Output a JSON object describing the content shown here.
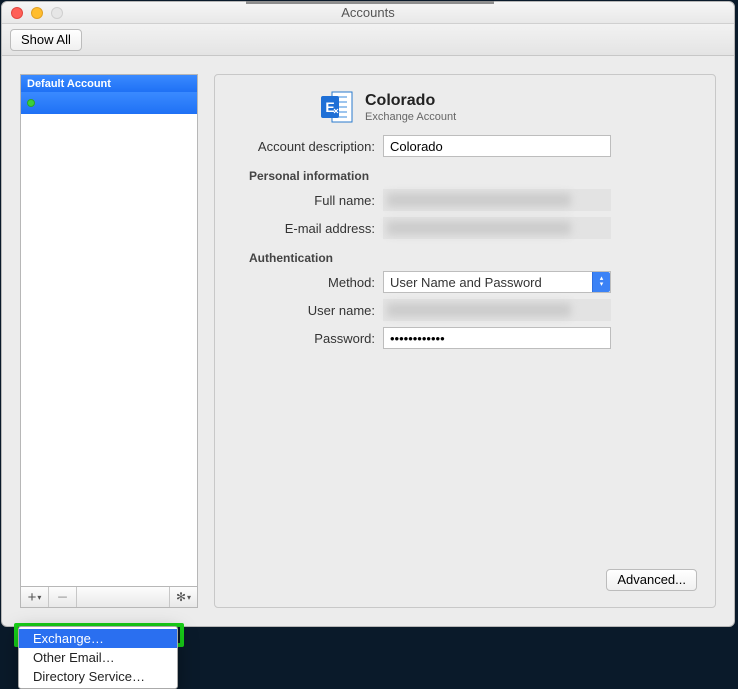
{
  "window": {
    "title": "Accounts",
    "show_all_label": "Show All"
  },
  "sidebar": {
    "header": "Default Account",
    "items": [
      {
        "status": "online",
        "label": ""
      }
    ],
    "footer": {
      "add_glyph": "＋⌄",
      "remove_glyph": "—",
      "gear_glyph": "⚙⌄"
    }
  },
  "popup": {
    "items": [
      {
        "label": "Exchange…",
        "selected": true
      },
      {
        "label": "Other Email…",
        "selected": false
      },
      {
        "label": "Directory Service…",
        "selected": false
      }
    ]
  },
  "detail": {
    "icon": "exchange-icon",
    "account_name": "Colorado",
    "account_type": "Exchange Account",
    "labels": {
      "description": "Account description:",
      "personal_section": "Personal information",
      "full_name": "Full name:",
      "email": "E-mail address:",
      "auth_section": "Authentication",
      "method": "Method:",
      "user": "User name:",
      "password": "Password:",
      "advanced": "Advanced..."
    },
    "values": {
      "description": "Colorado",
      "full_name": "",
      "email": "",
      "method": "User Name and Password",
      "user": "",
      "password": "••••••••••••"
    }
  },
  "colors": {
    "accent": "#2a6ff0",
    "highlight": "#18d018"
  }
}
